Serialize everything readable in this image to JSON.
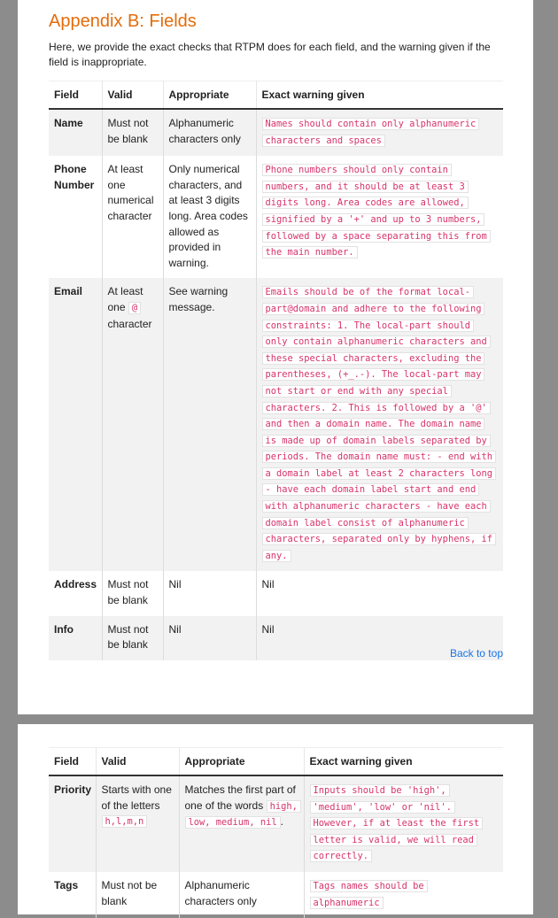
{
  "heading": "Appendix B: Fields",
  "intro": "Here, we provide the exact checks that RTPM does for each field, and the warning given if the field is inappropriate.",
  "table1": {
    "headers": [
      "Field",
      "Valid",
      "Appropriate",
      "Exact warning given"
    ],
    "rows": [
      {
        "field": "Name",
        "valid": "Must not be blank",
        "appropriate": "Alphanumeric characters only",
        "warning": "Names should contain only alphanumeric characters and spaces"
      },
      {
        "field": "Phone Number",
        "valid": "At least one numerical character",
        "appropriate": "Only numerical characters, and at least 3 digits long. Area codes allowed as provided in warning.",
        "warning": "Phone numbers should only contain numbers, and it should be at least 3 digits long. Area codes are allowed, signified by a '+' and up to 3 numbers, followed by a space separating this from the main number."
      },
      {
        "field": "Email",
        "valid_pre": "At least one",
        "valid_code": "@",
        "valid_post": "character",
        "appropriate": "See warning message.",
        "warning": "Emails should be of the format local-part@domain and adhere to the following constraints: 1. The local-part should only contain alphanumeric characters and these special characters, excluding the parentheses, (+_.-). The local-part may not start or end with any special characters. 2. This is followed by a '@' and then a domain name. The domain name is made up of domain labels separated by periods. The domain name must: - end with a domain label at least 2 characters long - have each domain label start and end with alphanumeric characters - have each domain label consist of alphanumeric characters, separated only by hyphens, if any."
      },
      {
        "field": "Address",
        "valid": "Must not be blank",
        "appropriate": "Nil",
        "warning": "Nil"
      },
      {
        "field": "Info",
        "valid": "Must not be blank",
        "appropriate": "Nil",
        "warning": "Nil"
      }
    ]
  },
  "back_to_top": "Back to top",
  "table2": {
    "headers": [
      "Field",
      "Valid",
      "Appropriate",
      "Exact warning given"
    ],
    "rows": [
      {
        "field": "Priority",
        "valid_pre": "Starts with one of the letters",
        "valid_code": "h,l,m,n",
        "appropriate_pre": "Matches the first part of one of the words",
        "appropriate_code": "high, low, medium, nil",
        "appropriate_post": ".",
        "warning": "Inputs should be 'high', 'medium', 'low' or 'nil'. However, if at least the first letter is valid, we will read correctly."
      },
      {
        "field": "Tags",
        "valid": "Must not be blank",
        "appropriate": "Alphanumeric characters only",
        "warning": "Tags names should be alphanumeric"
      }
    ]
  },
  "colors": {
    "heading": "#e46c0a",
    "code_text": "#d6336c",
    "link": "#1a73e8",
    "page_background": "#8c8c8c"
  }
}
